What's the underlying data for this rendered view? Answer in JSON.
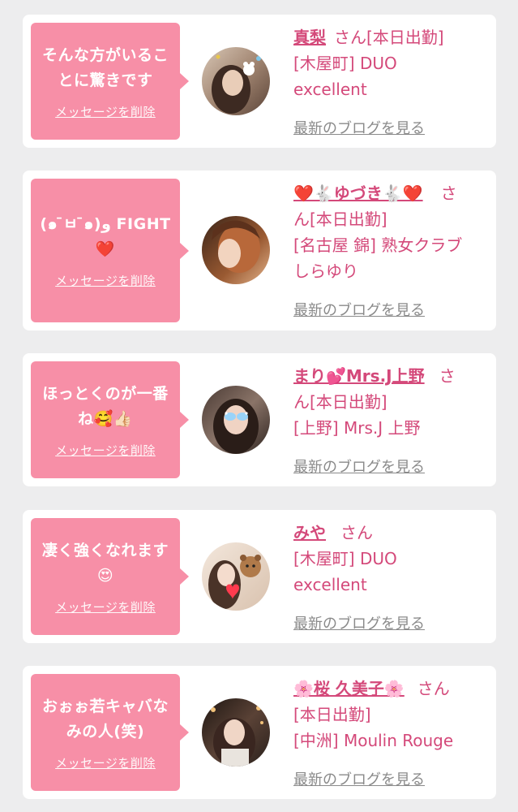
{
  "cards": [
    {
      "message_lines": [
        "そんな方がいるこ",
        "とに驚きです"
      ],
      "delete_label": "メッセージを削除",
      "name": "真梨",
      "honorific": "さん",
      "status": "[本日出勤]",
      "shop_lines": [
        "[木屋町] DUO",
        "excellent"
      ],
      "blog_label": "最新のブログを見る"
    },
    {
      "message_lines": [
        "(๑ ̄ㅂ ̄๑)ﻭ FIGHT",
        "❤️"
      ],
      "delete_label": "メッセージを削除",
      "name_lines": [
        "❤️🐇ゆづき🐇❤️"
      ],
      "honorific": "さ",
      "status_line": "ん[本日出勤]",
      "shop_lines": [
        "[名古屋 錦] 熟女クラブ",
        "しらゆり"
      ],
      "blog_label": "最新のブログを見る"
    },
    {
      "message_lines": [
        "ほっとくのが一番",
        "ね🥰👍🏻"
      ],
      "delete_label": "メッセージを削除",
      "name": "まり💕Mrs.J上野",
      "honorific": "さ",
      "status_line": "ん[本日出勤]",
      "shop_lines": [
        "[上野] Mrs.J 上野"
      ],
      "blog_label": "最新のブログを見る"
    },
    {
      "message_lines": [
        "凄く強くなれます",
        "😍"
      ],
      "delete_label": "メッセージを削除",
      "name": "みや",
      "honorific": "さん",
      "shop_lines": [
        "[木屋町] DUO",
        "excellent"
      ],
      "blog_label": "最新のブログを見る"
    },
    {
      "message_lines": [
        "おぉぉ若キャバな",
        "みの人(笑)"
      ],
      "delete_label": "メッセージを削除",
      "name": "🌸桜 久美子🌸",
      "honorific": "さん",
      "status": "[本日出勤]",
      "shop_lines": [
        "[中洲] Moulin Rouge"
      ],
      "blog_label": "最新のブログを見る"
    }
  ],
  "colors": {
    "page_bg": "#ededee",
    "card_bg": "#ffffff",
    "bubble_pink": "#f78fa7",
    "accent_pink": "#d4497a",
    "link_gray": "#8a8a8a"
  }
}
